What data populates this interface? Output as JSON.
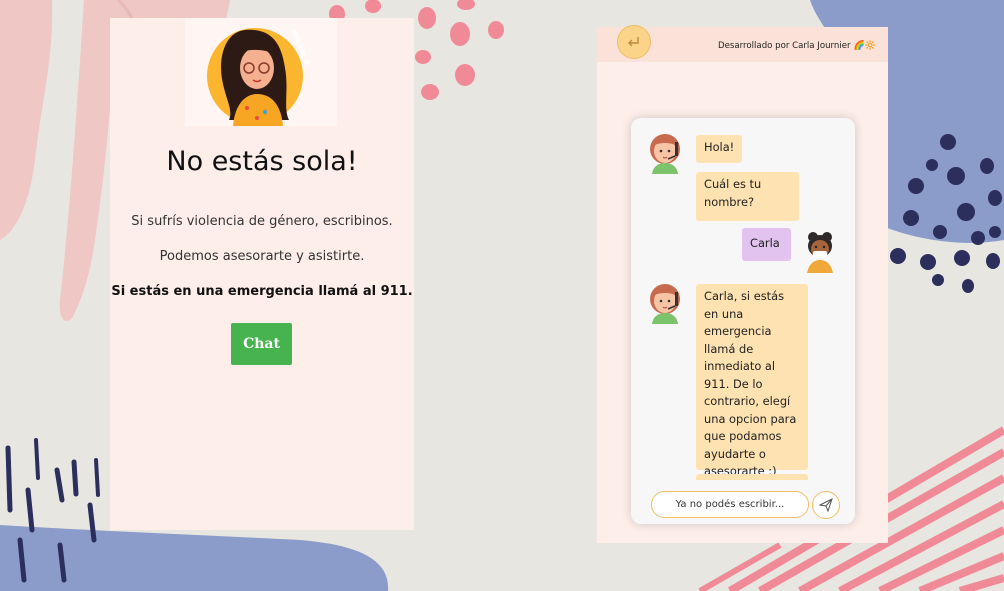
{
  "left_card": {
    "title": "No estás sola!",
    "line1": "Si sufrís violencia de género, escribinos.",
    "line2": "Podemos asesorarte y asistirte.",
    "line3": "Si estás en una emergencia llamá al 911.",
    "chat_button": "Chat"
  },
  "right_panel": {
    "developer_text": "Desarrollado por Carla Journier",
    "developer_emoji": "🌈🔆",
    "back_icon": "return-arrow-icon",
    "messages": [
      {
        "from": "bot",
        "text": "Hola!"
      },
      {
        "from": "bot",
        "text": "Cuál es tu nombre?"
      },
      {
        "from": "user",
        "text": "Carla"
      },
      {
        "from": "bot",
        "text": "Carla, si estás en una emergencia llamá de inmediato al 911. De lo contrario, elegí una opcion para que podamos ayudarte o asesorarte :)"
      }
    ],
    "input_placeholder": "Ya no podés escribir...",
    "send_icon": "paper-plane-icon"
  },
  "colors": {
    "bot_bubble": "#fee2b1",
    "user_bubble": "#e2c2ee",
    "chat_button": "#46b34f",
    "panel_bg": "#fdeeea"
  }
}
